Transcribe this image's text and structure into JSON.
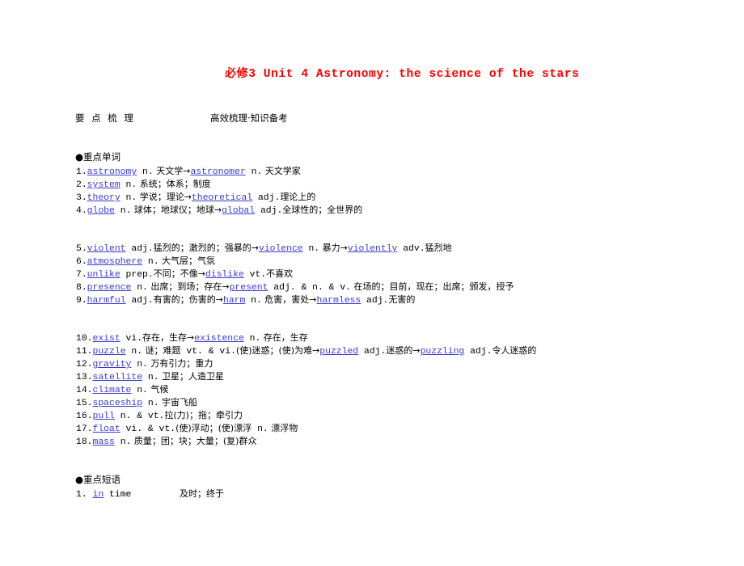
{
  "document": {
    "title_cn": "必修",
    "title_rest": "3  Unit 4  Astronomy: the science of the stars",
    "title_color": "#ff0000"
  },
  "subheader": {
    "left": "要 点 梳 理",
    "right": "高效梳理·知识备考"
  },
  "sections": {
    "words": {
      "heading": "●重点单词",
      "entries": [
        {
          "num": "1.",
          "parts": [
            {
              "t": "w",
              "v": "astronomy"
            },
            {
              "t": "en",
              "v": " n."
            },
            {
              "t": "cn",
              "v": " 天文学"
            },
            {
              "t": "arrow",
              "v": "→"
            },
            {
              "t": "w",
              "v": "astronomer"
            },
            {
              "t": "en",
              "v": " n."
            },
            {
              "t": "cn",
              "v": " 天文学家"
            }
          ]
        },
        {
          "num": "2.",
          "parts": [
            {
              "t": "w",
              "v": "system"
            },
            {
              "t": "en",
              "v": " n."
            },
            {
              "t": "cn",
              "v": " 系统；体系；制度"
            }
          ]
        },
        {
          "num": "3.",
          "parts": [
            {
              "t": "w",
              "v": "theory"
            },
            {
              "t": "en",
              "v": " n."
            },
            {
              "t": "cn",
              "v": " 学说；理论"
            },
            {
              "t": "arrow",
              "v": "→"
            },
            {
              "t": "w",
              "v": "theoretical"
            },
            {
              "t": "en",
              "v": " adj."
            },
            {
              "t": "cn",
              "v": "理论上的"
            }
          ]
        },
        {
          "num": "4.",
          "parts": [
            {
              "t": "w",
              "v": "globe"
            },
            {
              "t": "en",
              "v": " n."
            },
            {
              "t": "cn",
              "v": " 球体；地球仪；地球"
            },
            {
              "t": "arrow",
              "v": "→"
            },
            {
              "t": "w",
              "v": "global"
            },
            {
              "t": "en",
              "v": " adj."
            },
            {
              "t": "cn",
              "v": "全球性的；全世界的"
            }
          ]
        },
        {
          "num": "5.",
          "parts": [
            {
              "t": "w",
              "v": "violent"
            },
            {
              "t": "en",
              "v": " adj."
            },
            {
              "t": "cn",
              "v": "猛烈的；激烈的；强暴的"
            },
            {
              "t": "arrow",
              "v": "→"
            },
            {
              "t": "w",
              "v": "violence"
            },
            {
              "t": "en",
              "v": " n."
            },
            {
              "t": "cn",
              "v": " 暴力"
            },
            {
              "t": "arrow",
              "v": "→"
            },
            {
              "t": "w",
              "v": "violently"
            },
            {
              "t": "en",
              "v": " adv."
            },
            {
              "t": "cn",
              "v": "猛烈地"
            }
          ]
        },
        {
          "num": "6.",
          "parts": [
            {
              "t": "w",
              "v": "atmosphere"
            },
            {
              "t": "en",
              "v": " n."
            },
            {
              "t": "cn",
              "v": " 大气层；气氛"
            }
          ]
        },
        {
          "num": "7.",
          "parts": [
            {
              "t": "w",
              "v": "unlike"
            },
            {
              "t": "en",
              "v": " prep."
            },
            {
              "t": "cn",
              "v": "不同；不像"
            },
            {
              "t": "arrow",
              "v": "→"
            },
            {
              "t": "w",
              "v": "dislike"
            },
            {
              "t": "en",
              "v": " vt."
            },
            {
              "t": "cn",
              "v": "不喜欢"
            }
          ]
        },
        {
          "num": "8.",
          "parts": [
            {
              "t": "w",
              "v": "presence"
            },
            {
              "t": "en",
              "v": " n."
            },
            {
              "t": "cn",
              "v": " 出席；到场；存在"
            },
            {
              "t": "arrow",
              "v": "→"
            },
            {
              "t": "w",
              "v": "present"
            },
            {
              "t": "en",
              "v": " adj. & n. & v."
            },
            {
              "t": "cn",
              "v": " 在场的；目前，现在；出席；颁发，授予"
            }
          ]
        },
        {
          "num": "9.",
          "parts": [
            {
              "t": "w",
              "v": "harmful"
            },
            {
              "t": "en",
              "v": " adj."
            },
            {
              "t": "cn",
              "v": "有害的；伤害的"
            },
            {
              "t": "arrow",
              "v": "→"
            },
            {
              "t": "w",
              "v": "harm"
            },
            {
              "t": "en",
              "v": " n."
            },
            {
              "t": "cn",
              "v": " 危害，害处"
            },
            {
              "t": "arrow",
              "v": "→"
            },
            {
              "t": "w",
              "v": "harmless"
            },
            {
              "t": "en",
              "v": " adj."
            },
            {
              "t": "cn",
              "v": "无害的"
            }
          ]
        },
        {
          "num": "10.",
          "parts": [
            {
              "t": "w",
              "v": "exist"
            },
            {
              "t": "en",
              "v": " vi."
            },
            {
              "t": "cn",
              "v": "存在，生存"
            },
            {
              "t": "arrow",
              "v": "→"
            },
            {
              "t": "w",
              "v": "existence"
            },
            {
              "t": "en",
              "v": " n."
            },
            {
              "t": "cn",
              "v": " 存在，生存"
            }
          ]
        },
        {
          "num": "11.",
          "parts": [
            {
              "t": "w",
              "v": "puzzle"
            },
            {
              "t": "en",
              "v": " n."
            },
            {
              "t": "cn",
              "v": " 谜；难题"
            },
            {
              "t": "en",
              "v": " vt. & vi."
            },
            {
              "t": "cn",
              "v": "(使)迷惑；(使)为难"
            },
            {
              "t": "arrow",
              "v": "→"
            },
            {
              "t": "w",
              "v": "puzzled"
            },
            {
              "t": "en",
              "v": " adj."
            },
            {
              "t": "cn",
              "v": "迷惑的"
            },
            {
              "t": "arrow",
              "v": "→"
            },
            {
              "t": "w",
              "v": "puzzling"
            },
            {
              "t": "en",
              "v": " adj."
            },
            {
              "t": "cn",
              "v": "令人迷惑的"
            }
          ]
        },
        {
          "num": "12.",
          "parts": [
            {
              "t": "w",
              "v": "gravity"
            },
            {
              "t": "en",
              "v": " n."
            },
            {
              "t": "cn",
              "v": " 万有引力；重力"
            }
          ]
        },
        {
          "num": "13.",
          "parts": [
            {
              "t": "w",
              "v": "satellite"
            },
            {
              "t": "en",
              "v": " n."
            },
            {
              "t": "cn",
              "v": " 卫星；人造卫星"
            }
          ]
        },
        {
          "num": "14.",
          "parts": [
            {
              "t": "w",
              "v": "climate"
            },
            {
              "t": "en",
              "v": " n."
            },
            {
              "t": "cn",
              "v": " 气候"
            }
          ]
        },
        {
          "num": "15.",
          "parts": [
            {
              "t": "w",
              "v": "spaceship"
            },
            {
              "t": "en",
              "v": " n."
            },
            {
              "t": "cn",
              "v": " 宇宙飞船"
            }
          ]
        },
        {
          "num": "16.",
          "parts": [
            {
              "t": "w",
              "v": "pull"
            },
            {
              "t": "en",
              "v": " n. & vt."
            },
            {
              "t": "cn",
              "v": "拉(力)；拖；牵引力"
            }
          ]
        },
        {
          "num": "17.",
          "parts": [
            {
              "t": "w",
              "v": "float"
            },
            {
              "t": "en",
              "v": " vi. & vt."
            },
            {
              "t": "cn",
              "v": "(使)浮动；(使)漂浮"
            },
            {
              "t": "en",
              "v": " n."
            },
            {
              "t": "cn",
              "v": " 漂浮物"
            }
          ]
        },
        {
          "num": "18.",
          "parts": [
            {
              "t": "w",
              "v": "mass"
            },
            {
              "t": "en",
              "v": " n."
            },
            {
              "t": "cn",
              "v": " 质量；团；块；大量；(复)群众"
            }
          ]
        }
      ]
    },
    "phrases": {
      "heading": "●重点短语",
      "entries": [
        {
          "num": "1.",
          "word": "in",
          "rest": " time",
          "meaning": "及时；终于"
        }
      ]
    }
  }
}
